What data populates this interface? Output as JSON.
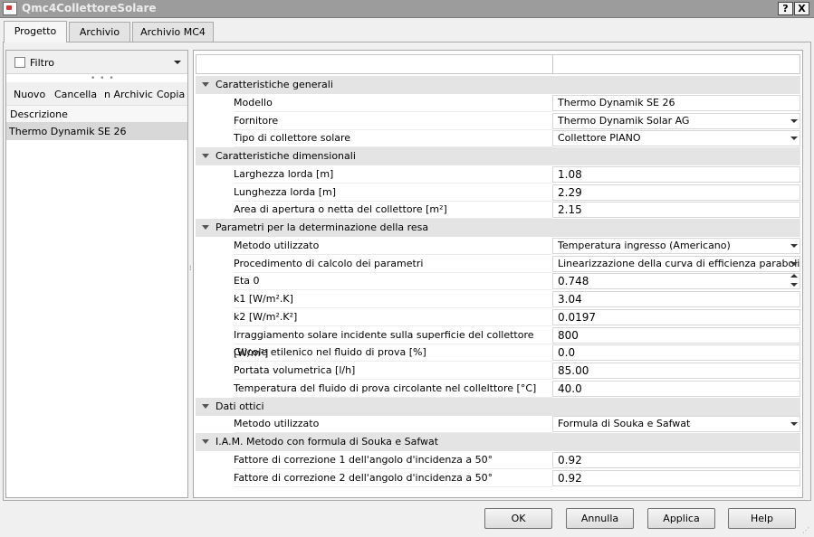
{
  "window": {
    "title": "Qmc4CollettoreSolare",
    "help_glyph": "?",
    "close_glyph": "X"
  },
  "tabs": [
    {
      "label": "Progetto"
    },
    {
      "label": "Archivio"
    },
    {
      "label": "Archivio MC4"
    }
  ],
  "left_panel": {
    "filter_label": "Filtro",
    "grip": "• • •",
    "buttons": {
      "nuovo": "Nuovo",
      "cancella": "Cancella",
      "archivio": "n Archivic",
      "copia": "Copia"
    },
    "list_header": "Descrizione",
    "items": [
      "Thermo Dynamik SE 26"
    ]
  },
  "splitter_glyph": "⁞",
  "grid": {
    "sections": [
      {
        "label": "Caratteristiche generali",
        "rows": [
          {
            "label": "Modello",
            "value": "Thermo Dynamik SE 26"
          },
          {
            "label": "Fornitore",
            "value": "Thermo Dynamik Solar AG",
            "dropdown": true
          },
          {
            "label": "Tipo di collettore solare",
            "value": "Collettore PIANO",
            "dropdown": true
          }
        ]
      },
      {
        "label": "Caratteristiche dimensionali",
        "rows": [
          {
            "label": "Larghezza lorda [m]",
            "value": "1.08"
          },
          {
            "label": "Lunghezza lorda [m]",
            "value": "2.29"
          },
          {
            "label": "Area di apertura o netta del collettore [m²]",
            "value": "2.15"
          }
        ]
      },
      {
        "label": "Parametri per la determinazione della resa",
        "rows": [
          {
            "label": "Metodo utilizzato",
            "value": "Temperatura ingresso (Americano)",
            "dropdown": true
          },
          {
            "label": "Procedimento di calcolo dei parametri",
            "value": "Linearizzazione della curva di efficienza parabolica",
            "dropdown": true
          },
          {
            "label": "Eta 0",
            "value": "0.748",
            "spinner": true
          },
          {
            "label": "k1 [W/m².K]",
            "value": "3.04"
          },
          {
            "label": "k2 [W/m².K²]",
            "value": "0.0197"
          },
          {
            "label": "Irraggiamento solare incidente sulla superficie del collettore [W/m²]",
            "value": "800"
          },
          {
            "label": "Glicole etilenico nel fluido di prova [%]",
            "value": "0.0"
          },
          {
            "label": "Portata volumetrica [l/h]",
            "value": "85.00"
          },
          {
            "label": "Temperatura del fluido di prova circolante nel collelttore [°C]",
            "value": "40.0"
          }
        ]
      },
      {
        "label": "Dati ottici",
        "rows": [
          {
            "label": "Metodo utilizzato",
            "value": "Formula di Souka e Safwat",
            "dropdown": true
          }
        ]
      },
      {
        "label": "I.A.M.  Metodo con  formula  di Souka e Safwat",
        "rows": [
          {
            "label": "Fattore di correzione 1 dell'angolo d'incidenza a 50°",
            "value": "0.92"
          },
          {
            "label": "Fattore di correzione 2 dell'angolo d'incidenza a 50°",
            "value": "0.92"
          }
        ]
      }
    ]
  },
  "footer_buttons": {
    "ok": "OK",
    "annulla": "Annulla",
    "applica": "Applica",
    "help": "Help"
  },
  "size_grip_glyph": "⋰"
}
